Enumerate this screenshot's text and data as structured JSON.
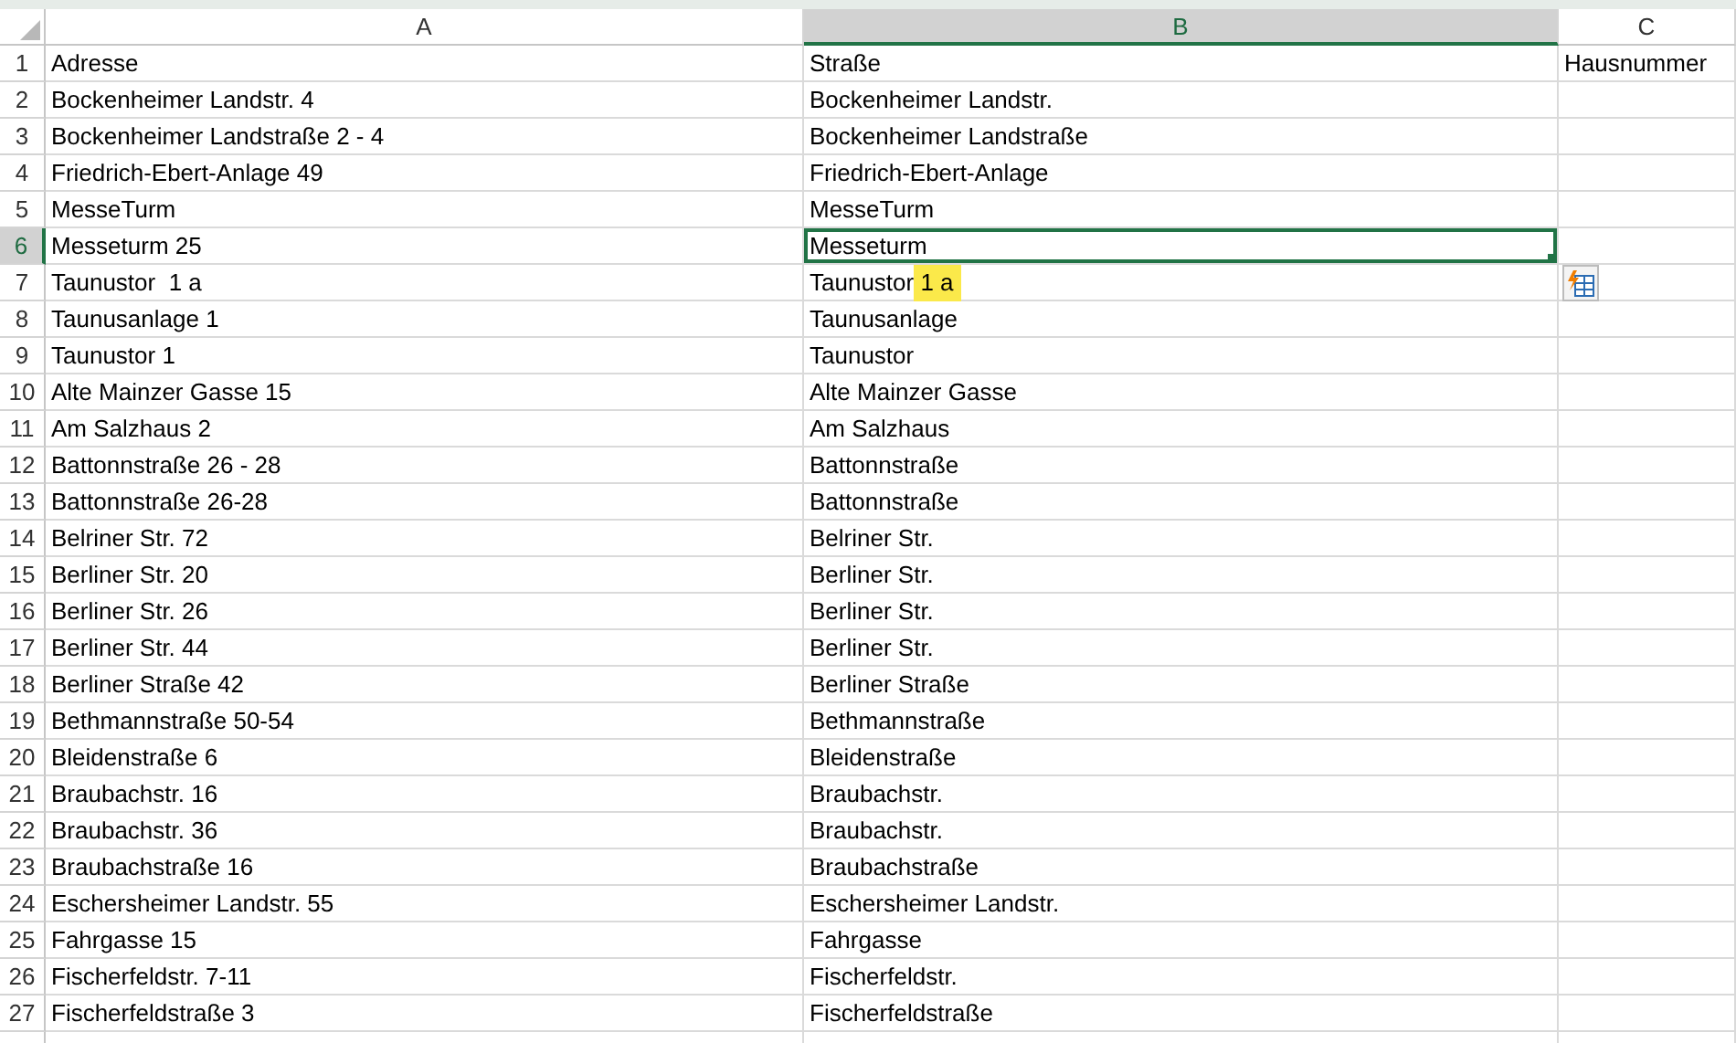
{
  "columns": [
    {
      "label": "A",
      "selected": false
    },
    {
      "label": "B",
      "selected": true
    },
    {
      "label": "C",
      "selected": false
    }
  ],
  "show_flash_fill_options": true,
  "rows": [
    {
      "number": "1",
      "selected": false,
      "cells": [
        {
          "text": "Adresse",
          "selected": false
        },
        {
          "text": "Straße",
          "selected": false
        },
        {
          "text": "Hausnummer",
          "selected": false
        }
      ]
    },
    {
      "number": "2",
      "selected": false,
      "cells": [
        {
          "text": "Bockenheimer Landstr. 4",
          "selected": false
        },
        {
          "text": "Bockenheimer Landstr.",
          "selected": false
        }
      ]
    },
    {
      "number": "3",
      "selected": false,
      "cells": [
        {
          "text": "Bockenheimer Landstraße 2 - 4",
          "selected": false
        },
        {
          "text": "Bockenheimer Landstraße",
          "selected": false
        }
      ]
    },
    {
      "number": "4",
      "selected": false,
      "cells": [
        {
          "text": "Friedrich-Ebert-Anlage 49",
          "selected": false
        },
        {
          "text": "Friedrich-Ebert-Anlage",
          "selected": false
        }
      ]
    },
    {
      "number": "5",
      "selected": false,
      "cells": [
        {
          "text": "MesseTurm",
          "selected": false
        },
        {
          "text": "MesseTurm",
          "selected": false
        }
      ]
    },
    {
      "number": "6",
      "selected": true,
      "cells": [
        {
          "text": "Messeturm 25",
          "selected": false
        },
        {
          "text": "Messeturm",
          "selected": true
        }
      ]
    },
    {
      "number": "7",
      "selected": false,
      "cells": [
        {
          "text": "Taunustor  1 a",
          "selected": false
        },
        {
          "text": "Taunustor",
          "highlight": " 1 a",
          "selected": false
        }
      ]
    },
    {
      "number": "8",
      "selected": false,
      "cells": [
        {
          "text": "Taunusanlage 1",
          "selected": false
        },
        {
          "text": "Taunusanlage",
          "selected": false
        }
      ]
    },
    {
      "number": "9",
      "selected": false,
      "cells": [
        {
          "text": "Taunustor 1",
          "selected": false
        },
        {
          "text": "Taunustor",
          "selected": false
        }
      ]
    },
    {
      "number": "10",
      "selected": false,
      "cells": [
        {
          "text": "Alte Mainzer Gasse 15",
          "selected": false
        },
        {
          "text": "Alte Mainzer Gasse",
          "selected": false
        }
      ]
    },
    {
      "number": "11",
      "selected": false,
      "cells": [
        {
          "text": "Am Salzhaus 2",
          "selected": false
        },
        {
          "text": "Am Salzhaus",
          "selected": false
        }
      ]
    },
    {
      "number": "12",
      "selected": false,
      "cells": [
        {
          "text": "Battonnstraße 26 - 28",
          "selected": false
        },
        {
          "text": "Battonnstraße",
          "selected": false
        }
      ]
    },
    {
      "number": "13",
      "selected": false,
      "cells": [
        {
          "text": "Battonnstraße 26-28",
          "selected": false
        },
        {
          "text": "Battonnstraße",
          "selected": false
        }
      ]
    },
    {
      "number": "14",
      "selected": false,
      "cells": [
        {
          "text": "Belriner Str. 72",
          "selected": false
        },
        {
          "text": "Belriner Str.",
          "selected": false
        }
      ]
    },
    {
      "number": "15",
      "selected": false,
      "cells": [
        {
          "text": "Berliner Str. 20",
          "selected": false
        },
        {
          "text": "Berliner Str.",
          "selected": false
        }
      ]
    },
    {
      "number": "16",
      "selected": false,
      "cells": [
        {
          "text": "Berliner Str. 26",
          "selected": false
        },
        {
          "text": "Berliner Str.",
          "selected": false
        }
      ]
    },
    {
      "number": "17",
      "selected": false,
      "cells": [
        {
          "text": "Berliner Str. 44",
          "selected": false
        },
        {
          "text": "Berliner Str.",
          "selected": false
        }
      ]
    },
    {
      "number": "18",
      "selected": false,
      "cells": [
        {
          "text": "Berliner Straße 42",
          "selected": false
        },
        {
          "text": "Berliner Straße",
          "selected": false
        }
      ]
    },
    {
      "number": "19",
      "selected": false,
      "cells": [
        {
          "text": "Bethmannstraße 50-54",
          "selected": false
        },
        {
          "text": "Bethmannstraße",
          "selected": false
        }
      ]
    },
    {
      "number": "20",
      "selected": false,
      "cells": [
        {
          "text": "Bleidenstraße 6",
          "selected": false
        },
        {
          "text": "Bleidenstraße",
          "selected": false
        }
      ]
    },
    {
      "number": "21",
      "selected": false,
      "cells": [
        {
          "text": "Braubachstr. 16",
          "selected": false
        },
        {
          "text": "Braubachstr.",
          "selected": false
        }
      ]
    },
    {
      "number": "22",
      "selected": false,
      "cells": [
        {
          "text": "Braubachstr. 36",
          "selected": false
        },
        {
          "text": "Braubachstr.",
          "selected": false
        }
      ]
    },
    {
      "number": "23",
      "selected": false,
      "cells": [
        {
          "text": "Braubachstraße 16",
          "selected": false
        },
        {
          "text": "Braubachstraße",
          "selected": false
        }
      ]
    },
    {
      "number": "24",
      "selected": false,
      "cells": [
        {
          "text": "Eschersheimer Landstr. 55",
          "selected": false
        },
        {
          "text": "Eschersheimer Landstr.",
          "selected": false
        }
      ]
    },
    {
      "number": "25",
      "selected": false,
      "cells": [
        {
          "text": "Fahrgasse 15",
          "selected": false
        },
        {
          "text": "Fahrgasse",
          "selected": false
        }
      ]
    },
    {
      "number": "26",
      "selected": false,
      "cells": [
        {
          "text": "Fischerfeldstr. 7-11",
          "selected": false
        },
        {
          "text": "Fischerfeldstr.",
          "selected": false
        }
      ]
    },
    {
      "number": "27",
      "selected": false,
      "cells": [
        {
          "text": "Fischerfeldstraße 3",
          "selected": false
        },
        {
          "text": "Fischerfeldstraße",
          "selected": false
        }
      ]
    }
  ]
}
